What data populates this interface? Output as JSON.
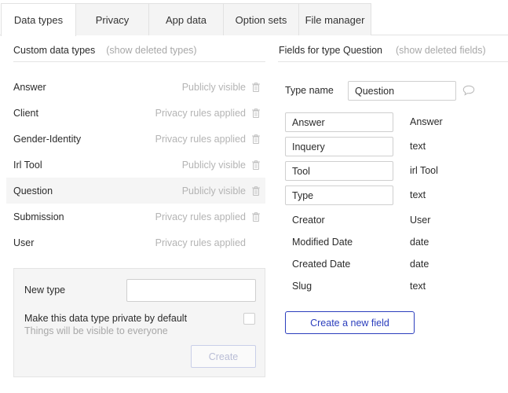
{
  "tabs": [
    {
      "label": "Data types",
      "active": true
    },
    {
      "label": "Privacy",
      "active": false
    },
    {
      "label": "App data",
      "active": false
    },
    {
      "label": "Option sets",
      "active": false
    },
    {
      "label": "File manager",
      "active": false
    }
  ],
  "left": {
    "title": "Custom data types",
    "show_deleted": "(show deleted types)",
    "types": [
      {
        "name": "Answer",
        "privacy": "Publicly visible",
        "deletable": true,
        "selected": false
      },
      {
        "name": "Client",
        "privacy": "Privacy rules applied",
        "deletable": true,
        "selected": false
      },
      {
        "name": "Gender-Identity",
        "privacy": "Privacy rules applied",
        "deletable": true,
        "selected": false
      },
      {
        "name": "Irl Tool",
        "privacy": "Publicly visible",
        "deletable": true,
        "selected": false
      },
      {
        "name": "Question",
        "privacy": "Publicly visible",
        "deletable": true,
        "selected": true
      },
      {
        "name": "Submission",
        "privacy": "Privacy rules applied",
        "deletable": true,
        "selected": false
      },
      {
        "name": "User",
        "privacy": "Privacy rules applied",
        "deletable": false,
        "selected": false
      }
    ],
    "new_type": {
      "label": "New type",
      "value": "",
      "private_label": "Make this data type private by default",
      "private_sub": "Things will be visible to everyone",
      "private_checked": false,
      "create_label": "Create"
    }
  },
  "right": {
    "title": "Fields for type Question",
    "show_deleted": "(show deleted fields)",
    "type_name_label": "Type name",
    "type_name_value": "Question",
    "fields": [
      {
        "name": "Answer",
        "type": "Answer",
        "editable": true
      },
      {
        "name": "Inquery",
        "type": "text",
        "editable": true
      },
      {
        "name": "Tool",
        "type": "irl Tool",
        "editable": true
      },
      {
        "name": "Type",
        "type": "text",
        "editable": true
      },
      {
        "name": "Creator",
        "type": "User",
        "editable": false
      },
      {
        "name": "Modified Date",
        "type": "date",
        "editable": false
      },
      {
        "name": "Created Date",
        "type": "date",
        "editable": false
      },
      {
        "name": "Slug",
        "type": "text",
        "editable": false
      }
    ],
    "new_field_label": "Create a new field"
  },
  "icons": {
    "trash": "trash-icon",
    "comment": "comment-icon"
  },
  "colors": {
    "accent": "#2b3ebd",
    "muted_text": "#b4b4b4",
    "selected_row": "#f5f5f5"
  }
}
